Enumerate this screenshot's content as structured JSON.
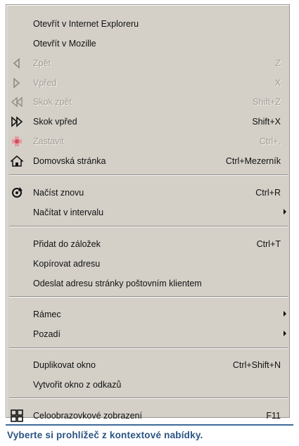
{
  "menu": {
    "items": [
      {
        "label": "Otevřít v Internet Exploreru",
        "shortcut": "",
        "disabled": false,
        "icon": "",
        "submenu": false
      },
      {
        "label": "Otevřít v Mozille",
        "shortcut": "",
        "disabled": false,
        "icon": "",
        "submenu": false
      },
      {
        "label": "Zpět",
        "shortcut": "Z",
        "disabled": true,
        "icon": "back-arrow-icon",
        "submenu": false
      },
      {
        "label": "Vpřed",
        "shortcut": "X",
        "disabled": true,
        "icon": "forward-arrow-icon",
        "submenu": false
      },
      {
        "label": "Skok zpět",
        "shortcut": "Shift+Z",
        "disabled": true,
        "icon": "rewind-icon",
        "submenu": false
      },
      {
        "label": "Skok vpřed",
        "shortcut": "Shift+X",
        "disabled": false,
        "icon": "fast-forward-icon",
        "submenu": false
      },
      {
        "label": "Zastavit",
        "shortcut": "Ctrl+.",
        "disabled": true,
        "icon": "stop-icon",
        "submenu": false
      },
      {
        "label": "Domovská stránka",
        "shortcut": "Ctrl+Mezerník",
        "disabled": false,
        "icon": "home-icon",
        "submenu": false
      },
      {
        "label": "Načíst znovu",
        "shortcut": "Ctrl+R",
        "disabled": false,
        "icon": "reload-icon",
        "submenu": false
      },
      {
        "label": "Načítat v intervalu",
        "shortcut": "",
        "disabled": false,
        "icon": "",
        "submenu": true
      },
      {
        "label": "Přidat do záložek",
        "shortcut": "Ctrl+T",
        "disabled": false,
        "icon": "",
        "submenu": false
      },
      {
        "label": "Kopírovat adresu",
        "shortcut": "",
        "disabled": false,
        "icon": "",
        "submenu": false
      },
      {
        "label": "Odeslat adresu stránky poštovním klientem",
        "shortcut": "",
        "disabled": false,
        "icon": "",
        "submenu": false
      },
      {
        "label": "Rámec",
        "shortcut": "",
        "disabled": false,
        "icon": "",
        "submenu": true
      },
      {
        "label": "Pozadí",
        "shortcut": "",
        "disabled": false,
        "icon": "",
        "submenu": true
      },
      {
        "label": "Duplikovat okno",
        "shortcut": "Ctrl+Shift+N",
        "disabled": false,
        "icon": "",
        "submenu": false
      },
      {
        "label": "Vytvořit okno z odkazů",
        "shortcut": "",
        "disabled": false,
        "icon": "",
        "submenu": false
      },
      {
        "label": "Celoobrazovkové zobrazení",
        "shortcut": "F11",
        "disabled": false,
        "icon": "fullscreen-icon",
        "submenu": false
      }
    ]
  },
  "caption": "Vyberte si prohlížeč z kontextové nabídky.",
  "colors": {
    "menu_bg": "#d4d0c8",
    "disabled_text": "#a19d96",
    "caption": "#2a5384",
    "caption_rule": "#3e6a9b"
  }
}
